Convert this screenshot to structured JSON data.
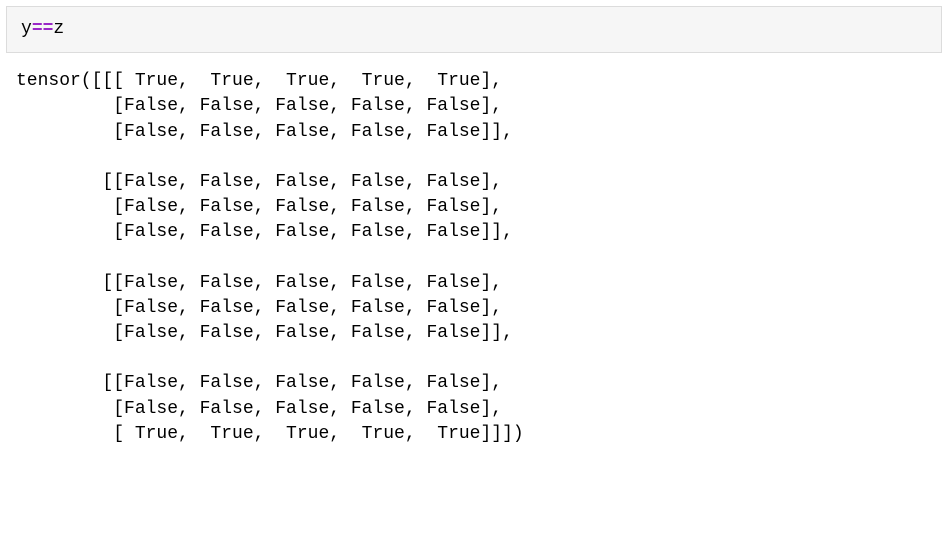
{
  "code": {
    "lhs": "y",
    "operator": "==",
    "rhs": "z"
  },
  "output": "tensor([[[ True,  True,  True,  True,  True],\n         [False, False, False, False, False],\n         [False, False, False, False, False]],\n\n        [[False, False, False, False, False],\n         [False, False, False, False, False],\n         [False, False, False, False, False]],\n\n        [[False, False, False, False, False],\n         [False, False, False, False, False],\n         [False, False, False, False, False]],\n\n        [[False, False, False, False, False],\n         [False, False, False, False, False],\n         [ True,  True,  True,  True,  True]]])"
}
